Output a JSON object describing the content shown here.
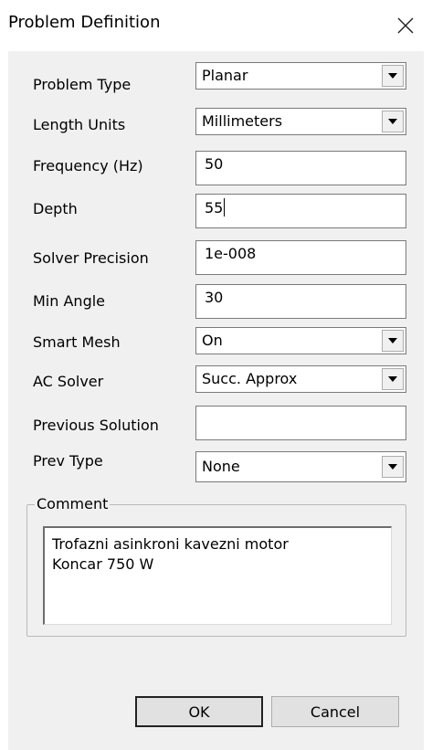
{
  "window": {
    "title": "Problem Definition",
    "close_glyph": "close-icon"
  },
  "fields": {
    "problem_type": {
      "label": "Problem Type",
      "value": "Planar"
    },
    "length_units": {
      "label": "Length Units",
      "value": "Millimeters"
    },
    "frequency": {
      "label": "Frequency (Hz)",
      "value": "50"
    },
    "depth": {
      "label": "Depth",
      "value": "55"
    },
    "solver_precision": {
      "label": "Solver Precision",
      "value": "1e-008"
    },
    "min_angle": {
      "label": "Min Angle",
      "value": "30"
    },
    "smart_mesh": {
      "label": "Smart Mesh",
      "value": "On"
    },
    "ac_solver": {
      "label": "AC Solver",
      "value": "Succ. Approx"
    },
    "previous_solution": {
      "label": "Previous Solution",
      "value": ""
    },
    "prev_type": {
      "label": "Prev Type",
      "value": "None"
    }
  },
  "comment": {
    "legend": "Comment",
    "lines": [
      "Trofazni asinkroni kavezni motor",
      "Koncar 750 W"
    ]
  },
  "buttons": {
    "ok": "OK",
    "cancel": "Cancel"
  }
}
